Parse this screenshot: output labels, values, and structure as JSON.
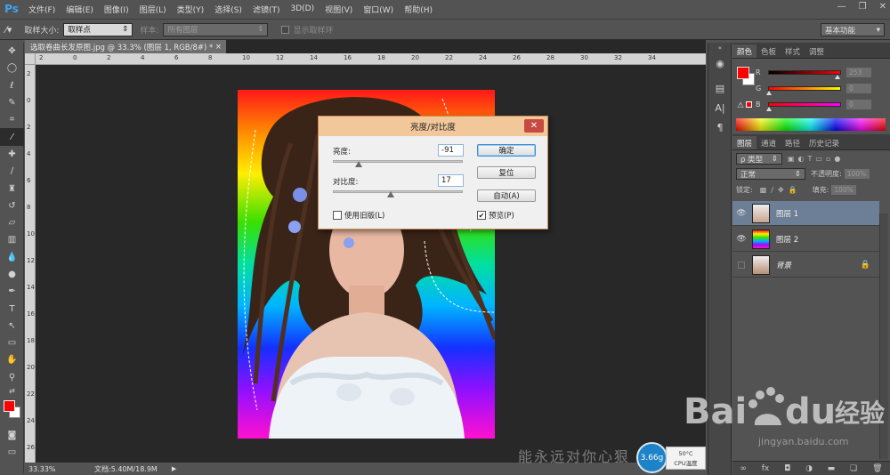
{
  "app": {
    "logo": "Ps"
  },
  "menu": [
    "文件(F)",
    "编辑(E)",
    "图像(I)",
    "图层(L)",
    "类型(Y)",
    "选择(S)",
    "滤镜(T)",
    "3D(D)",
    "视图(V)",
    "窗口(W)",
    "帮助(H)"
  ],
  "window_controls": {
    "minimize": "—",
    "restore": "❐",
    "close": "✕"
  },
  "options": {
    "sample_size_label": "取样大小:",
    "sample_size_value": "取样点",
    "sample_label": "样本:",
    "sample_value": "所有图层",
    "show_ring_label": "显示取样环",
    "workspace": "基本功能"
  },
  "document": {
    "tab_title": "选取卷曲长发原图.jpg @ 33.3% (图层 1, RGB/8#) *",
    "tab_close": "×",
    "ruler_h": [
      "2",
      "0",
      "2",
      "4",
      "6",
      "8",
      "10",
      "12",
      "14",
      "16",
      "18",
      "20",
      "22",
      "24",
      "26",
      "28",
      "30",
      "32",
      "34"
    ],
    "ruler_v": [
      "2",
      "0",
      "2",
      "4",
      "6",
      "8",
      "10",
      "12",
      "14",
      "16",
      "18",
      "20",
      "22",
      "24",
      "26"
    ]
  },
  "status": {
    "zoom": "33.33%",
    "doc_size": "文档:5.40M/18.9M",
    "arrow": "▶"
  },
  "dialog": {
    "title": "亮度/对比度",
    "close": "✕",
    "brightness_label": "亮度:",
    "brightness_value": "-91",
    "brightness_level": -91,
    "contrast_label": "对比度:",
    "contrast_value": "17",
    "contrast_level": 17,
    "ok": "确定",
    "reset": "复位",
    "auto": "自动(A)",
    "legacy_label": "使用旧版(L)",
    "legacy_checked": false,
    "preview_label": "预览(P)",
    "preview_checked": true,
    "check_mark": "✔"
  },
  "color_panel": {
    "tabs": [
      "颜色",
      "色板",
      "样式",
      "调整"
    ],
    "rows": [
      {
        "label": "R",
        "value": "253"
      },
      {
        "label": "G",
        "value": "0"
      },
      {
        "label": "B",
        "value": "0"
      }
    ],
    "foreground": "#ff0000",
    "background": "#ffffff"
  },
  "layers_panel": {
    "tabs": [
      "图层",
      "通道",
      "路径",
      "历史记录"
    ],
    "filter_label": "ρ 类型",
    "blend_mode": "正常",
    "opacity_label": "不透明度:",
    "opacity_value": "100%",
    "lock_label": "锁定:",
    "fill_label": "填充:",
    "fill_value": "100%",
    "layers": [
      {
        "name": "图层 1",
        "visible": true,
        "selected": true
      },
      {
        "name": "图层 2",
        "visible": true,
        "selected": false
      },
      {
        "name": "背景",
        "visible": false,
        "selected": false,
        "locked": true
      }
    ],
    "footer_icons": [
      "link-icon",
      "fx-icon",
      "mask-icon",
      "adjustment-icon",
      "folder-icon",
      "new-layer-icon",
      "trash-icon"
    ]
  },
  "overlay": {
    "watermark_text": "能永远对你心狠",
    "cpu_value": "3.66g",
    "cpu_temp": "50°C",
    "cpu_label": "CPU温度",
    "baidu_url": "jingyan.baidu.com",
    "baidu_logo_text": "Bai",
    "baidu_logo_text2": "du",
    "baidu_cn": "经验"
  },
  "colors": {
    "dialog_title_bg": "#f2c79a",
    "selected_layer": "#6d7f97",
    "accent_blue": "#3fa3f0"
  }
}
